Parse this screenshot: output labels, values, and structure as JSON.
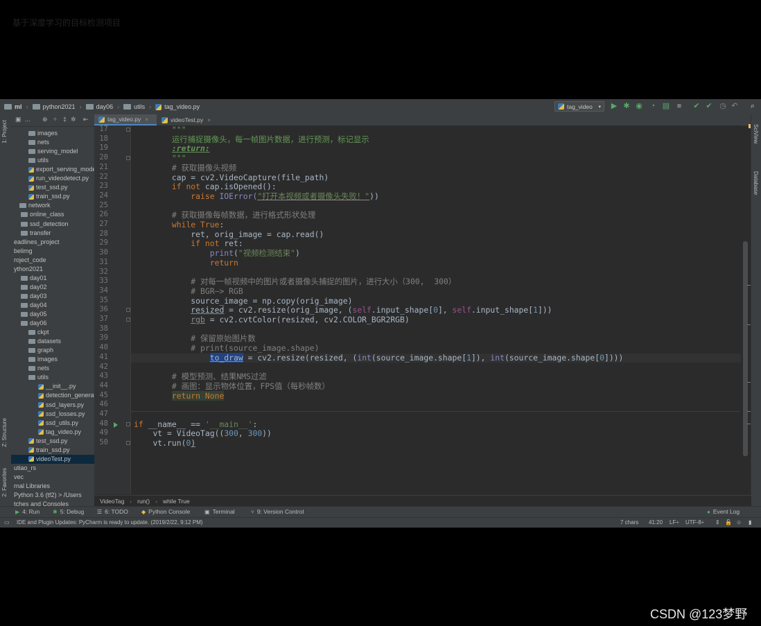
{
  "video_title": "基于深度学习的目标检测项目",
  "watermark": "CSDN @123梦野",
  "navbar": {
    "crumbs": [
      {
        "label": "ml",
        "type": "folder",
        "bold": true
      },
      {
        "label": "python2021",
        "type": "folder"
      },
      {
        "label": "day06",
        "type": "folder"
      },
      {
        "label": "utils",
        "type": "folder"
      },
      {
        "label": "tag_video.py",
        "type": "py"
      }
    ],
    "run_config": "tag_video",
    "run_config_dropdown": "▾"
  },
  "side_tabs": {
    "project": "1: Project",
    "structure": "Z: Structure",
    "favorites": "2: Favorites",
    "sciview": "SciView",
    "database": "Database"
  },
  "project_toolbar": {
    "label": "..."
  },
  "project_tree": [
    {
      "label": "images",
      "type": "folder",
      "indent": 5
    },
    {
      "label": "nets",
      "type": "folder",
      "indent": 5
    },
    {
      "label": "serving_model",
      "type": "folder",
      "indent": 5
    },
    {
      "label": "utils",
      "type": "folder",
      "indent": 5
    },
    {
      "label": "export_serving_model",
      "type": "py",
      "indent": 5
    },
    {
      "label": "run_videodetect.py",
      "type": "py",
      "indent": 5
    },
    {
      "label": "test_ssd.py",
      "type": "py",
      "indent": 5
    },
    {
      "label": "train_ssd.py",
      "type": "py",
      "indent": 5
    },
    {
      "label": "network",
      "type": "folder",
      "indent": -8
    },
    {
      "label": "online_class",
      "type": "folder",
      "indent": -6
    },
    {
      "label": "ssd_detection",
      "type": "folder",
      "indent": -6
    },
    {
      "label": "transfer",
      "type": "folder",
      "indent": -6
    },
    {
      "label": "eadlines_project",
      "type": "text",
      "indent": -16
    },
    {
      "label": "belimg",
      "type": "text",
      "indent": -16
    },
    {
      "label": "roject_code",
      "type": "text",
      "indent": -16
    },
    {
      "label": "ython2021",
      "type": "text",
      "indent": -16
    },
    {
      "label": "day01",
      "type": "folder",
      "indent": -6
    },
    {
      "label": "day02",
      "type": "folder",
      "indent": -6
    },
    {
      "label": "day03",
      "type": "folder",
      "indent": -6
    },
    {
      "label": "day04",
      "type": "folder",
      "indent": -6
    },
    {
      "label": "day05",
      "type": "folder",
      "indent": -6
    },
    {
      "label": "day06",
      "type": "folder",
      "indent": -6
    },
    {
      "label": "ckpt",
      "type": "folder",
      "indent": 5
    },
    {
      "label": "datasets",
      "type": "folder",
      "indent": 5
    },
    {
      "label": "graph",
      "type": "folder",
      "indent": 5
    },
    {
      "label": "images",
      "type": "folder",
      "indent": 5
    },
    {
      "label": "nets",
      "type": "folder",
      "indent": 5
    },
    {
      "label": "utils",
      "type": "folder",
      "indent": 5
    },
    {
      "label": "__init__.py",
      "type": "py",
      "indent": 19
    },
    {
      "label": "detection_generate",
      "type": "py",
      "indent": 19
    },
    {
      "label": "ssd_layers.py",
      "type": "py",
      "indent": 19
    },
    {
      "label": "ssd_losses.py",
      "type": "py",
      "indent": 19
    },
    {
      "label": "ssd_utils.py",
      "type": "py",
      "indent": 19
    },
    {
      "label": "tag_video.py",
      "type": "py",
      "indent": 19
    },
    {
      "label": "test_ssd.py",
      "type": "py",
      "indent": 5
    },
    {
      "label": "train_ssd.py",
      "type": "py",
      "indent": 5
    },
    {
      "label": "videoTest.py",
      "type": "py",
      "indent": 5,
      "selected": true
    },
    {
      "label": "utiao_rs",
      "type": "text",
      "indent": -16
    },
    {
      "label": "vec",
      "type": "text",
      "indent": -16
    },
    {
      "label": "rnal Libraries",
      "type": "text",
      "indent": -16
    },
    {
      "label": "Python 3.6 (tf2) > /Users",
      "type": "text",
      "indent": -16
    },
    {
      "label": "tches and Consoles",
      "type": "text",
      "indent": -16
    }
  ],
  "editor_tabs": [
    {
      "label": "tag_video.py",
      "active": true
    },
    {
      "label": "videoTest.py",
      "active": false
    }
  ],
  "tab_close": "×",
  "code": {
    "l17": "\"\"\"",
    "l18": "运行捕捉摄像头，每一帧图片数据，进行预测，标记显示",
    "l19": ":return:",
    "l20": "\"\"\"",
    "l21": "# 获取摄像头视频",
    "l22": "cap = cv2.VideoCapture(file_path)",
    "l23a": "if not ",
    "l23b": "cap.isOpened():",
    "l24a": "raise ",
    "l24b": "IOError(",
    "l24c": "\"打开本视频或者摄像头失败！\"",
    "l24d": "))",
    "l26": "# 获取摄像每帧数据，进行格式形状处理",
    "l27a": "while ",
    "l27b": "True",
    "l27c": ":",
    "l28": "ret, orig_image = cap.read()",
    "l29a": "if not ",
    "l29b": "ret:",
    "l30a": "print",
    "l30b": "(",
    "l30c": "\"视频检测结束\"",
    "l30d": ")",
    "l31": "return",
    "l33": "# 对每一帧视频中的图片或者摄像头捕捉的图片，进行大小（300,  300）",
    "l34": "# BGR—> RGB",
    "l35": "source_image = np.copy(orig_image)",
    "l36a": "resized",
    "l36b": " = cv2.resize(orig_image, (",
    "l36c": "self",
    "l36d": ".input_shape[",
    "l36e": "0",
    "l36f": "], ",
    "l36g": "self",
    "l36h": ".input_shape[",
    "l36i": "1",
    "l36j": "]))",
    "l37a": "rgb",
    "l37b": " = cv2.cvtColor(resized, cv2.COLOR_BGR2RGB)",
    "l39": "# 保留原始图片数",
    "l40": "# print(source_image.shape)",
    "l41a": "to_draw",
    "l41b": " = cv2.resize(resized, (",
    "l41c": "int",
    "l41d": "(source_image.shape[",
    "l41e": "1",
    "l41f": "]), ",
    "l41g": "int",
    "l41h": "(source_image.shape[",
    "l41i": "0",
    "l41j": "])))",
    "l43": "# 模型预测、结果NMS过滤",
    "l44": "# 画图：显示物体位置，FPS值（每秒帧数）",
    "l45a": "return ",
    "l45b": "None",
    "l48a": "if ",
    "l48b": "__name__ == ",
    "l48c": "'__main__'",
    "l48d": ":",
    "l49a": "vt = VideoTag((",
    "l49b": "300",
    "l49c": ", ",
    "l49d": "300",
    "l49e": "))",
    "l50a": "vt.run(",
    "l50b": "0",
    "l50c": ")"
  },
  "line_numbers": [
    "17",
    "18",
    "19",
    "20",
    "21",
    "22",
    "23",
    "24",
    "25",
    "26",
    "27",
    "28",
    "29",
    "30",
    "31",
    "32",
    "33",
    "34",
    "35",
    "36",
    "37",
    "38",
    "39",
    "40",
    "41",
    "42",
    "43",
    "44",
    "45",
    "46",
    "47",
    "48",
    "49",
    "50"
  ],
  "editor_breadcrumb": [
    "VideoTag",
    "run()",
    "while True"
  ],
  "bottom_tools": [
    {
      "label": "4: Run",
      "icon": "▶",
      "color": "#59a869"
    },
    {
      "label": "5: Debug",
      "icon": "✱",
      "color": "#59a869"
    },
    {
      "label": "6: TODO",
      "icon": "☰",
      "color": "#bbbbbb"
    },
    {
      "label": "Python Console",
      "icon": "◆",
      "color": "#e3c04a"
    },
    {
      "label": "Terminal",
      "icon": "▣",
      "color": "#bbbbbb"
    },
    {
      "label": "9: Version Control",
      "icon": "⑂",
      "color": "#bbbbbb"
    }
  ],
  "event_log": "Event Log",
  "status": {
    "message": "IDE and Plugin Updates: PyCharm is ready to update. (2019/2/22, 9:12 PM)",
    "chars": "7 chars",
    "position": "41:20",
    "line_sep": "LF÷",
    "encoding": "UTF-8÷"
  },
  "colors": {
    "ide_bg": "#2b2b2b",
    "panel_bg": "#3c3f41",
    "keyword": "#cc7832",
    "string": "#6a8759",
    "number": "#6897bb",
    "comment": "#808080",
    "accent": "#4a88c7"
  }
}
